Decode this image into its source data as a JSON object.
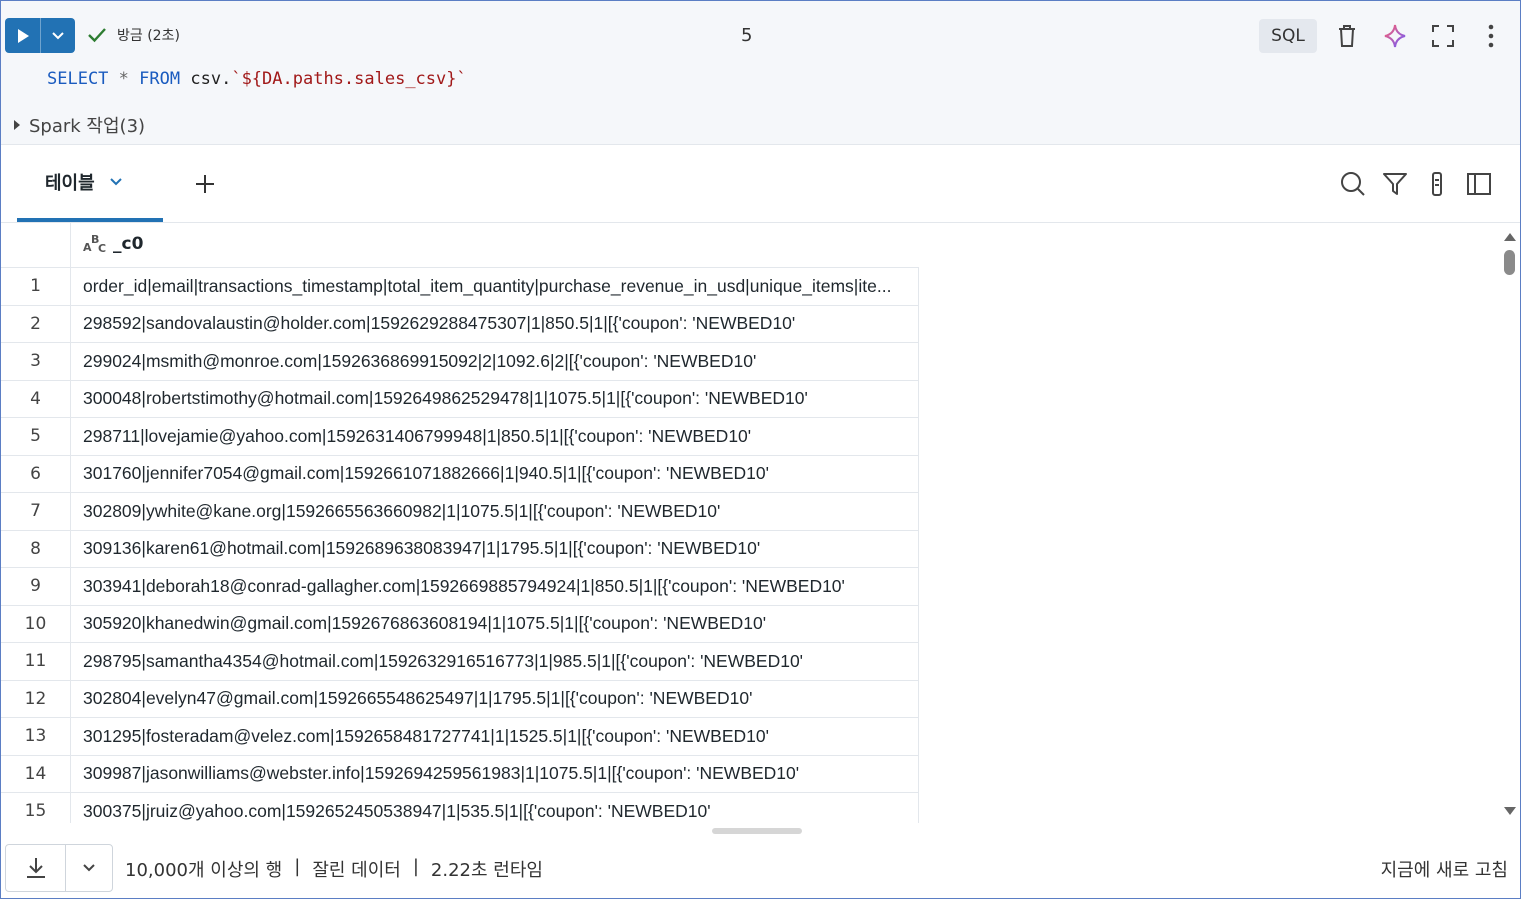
{
  "toolbar": {
    "status_text": "방금 (2초)",
    "command_number": "5",
    "language_badge": "SQL"
  },
  "code": {
    "kw_select": "SELECT",
    "star": "*",
    "kw_from": "FROM",
    "table_prefix": "csv.",
    "path_literal": "`${DA.paths.sales_csv}`"
  },
  "spark_jobs_label": "Spark 작업(3)",
  "results_tab": {
    "label": "테이블"
  },
  "table": {
    "column_name": "_c0",
    "type_icon": "string-type-icon",
    "rows": [
      {
        "n": "1",
        "v": "order_id|email|transactions_timestamp|total_item_quantity|purchase_revenue_in_usd|unique_items|ite..."
      },
      {
        "n": "2",
        "v": "298592|sandovalaustin@holder.com|1592629288475307|1|850.5|1|[{'coupon': 'NEWBED10'"
      },
      {
        "n": "3",
        "v": "299024|msmith@monroe.com|1592636869915092|2|1092.6|2|[{'coupon': 'NEWBED10'"
      },
      {
        "n": "4",
        "v": "300048|robertstimothy@hotmail.com|1592649862529478|1|1075.5|1|[{'coupon': 'NEWBED10'"
      },
      {
        "n": "5",
        "v": "298711|lovejamie@yahoo.com|1592631406799948|1|850.5|1|[{'coupon': 'NEWBED10'"
      },
      {
        "n": "6",
        "v": "301760|jennifer7054@gmail.com|1592661071882666|1|940.5|1|[{'coupon': 'NEWBED10'"
      },
      {
        "n": "7",
        "v": "302809|ywhite@kane.org|1592665563660982|1|1075.5|1|[{'coupon': 'NEWBED10'"
      },
      {
        "n": "8",
        "v": "309136|karen61@hotmail.com|1592689638083947|1|1795.5|1|[{'coupon': 'NEWBED10'"
      },
      {
        "n": "9",
        "v": "303941|deborah18@conrad-gallagher.com|1592669885794924|1|850.5|1|[{'coupon': 'NEWBED10'"
      },
      {
        "n": "10",
        "v": "305920|khanedwin@gmail.com|1592676863608194|1|1075.5|1|[{'coupon': 'NEWBED10'"
      },
      {
        "n": "11",
        "v": "298795|samantha4354@hotmail.com|1592632916516773|1|985.5|1|[{'coupon': 'NEWBED10'"
      },
      {
        "n": "12",
        "v": "302804|evelyn47@gmail.com|1592665548625497|1|1795.5|1|[{'coupon': 'NEWBED10'"
      },
      {
        "n": "13",
        "v": "301295|fosteradam@velez.com|1592658481727741|1|1525.5|1|[{'coupon': 'NEWBED10'"
      },
      {
        "n": "14",
        "v": "309987|jasonwilliams@webster.info|1592694259561983|1|1075.5|1|[{'coupon': 'NEWBED10'"
      },
      {
        "n": "15",
        "v": "300375|jruiz@yahoo.com|1592652450538947|1|535.5|1|[{'coupon': 'NEWBED10'"
      }
    ]
  },
  "footer": {
    "row_count": "10,000개 이상의 행",
    "sep1": "|",
    "truncated": "잘린 데이터",
    "sep2": "|",
    "runtime": "2.22초 런타임",
    "refresh": "지금에 새로 고침"
  },
  "colors": {
    "accent": "#2272b4",
    "success": "#2e7d32"
  }
}
